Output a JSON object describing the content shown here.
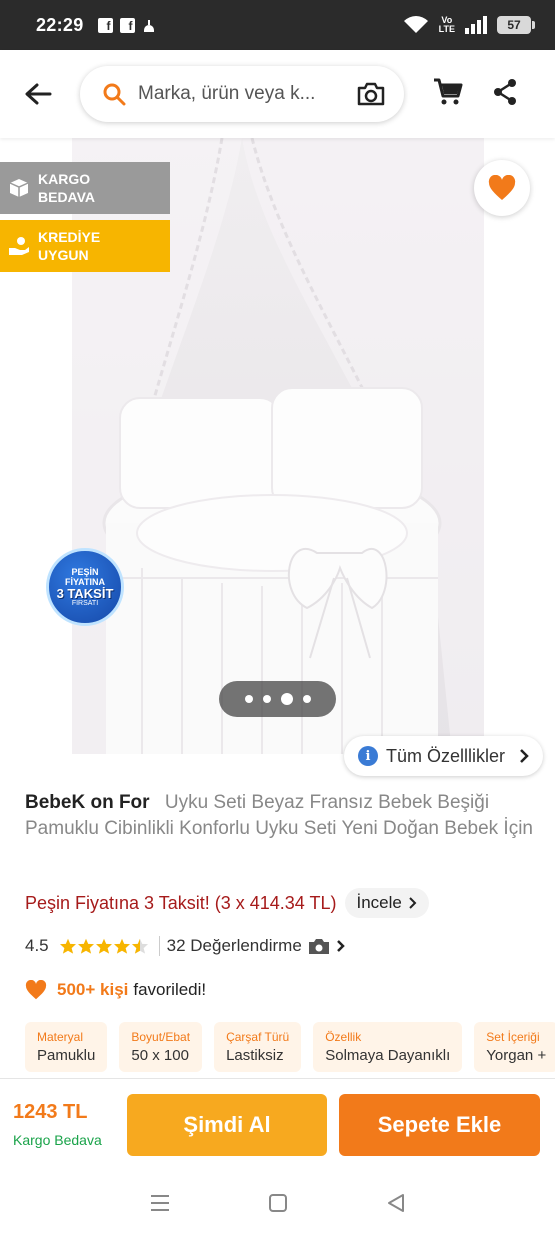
{
  "status": {
    "time": "22:29",
    "volte": [
      "Vo",
      "LTE"
    ],
    "battery": "57"
  },
  "search": {
    "placeholder": "Marka, ürün veya k..."
  },
  "badges": {
    "kargo": "KARGO BEDAVA",
    "kredi": "KREDİYE UYGUN"
  },
  "taksit_badge": {
    "line1": "PEŞİN FİYATINA",
    "line2": "3 TAKSİT",
    "line3": "FIRSATI"
  },
  "gallery": {
    "image_count": 4,
    "active_index": 2,
    "features_label": "Tüm Özelllikler"
  },
  "product": {
    "brand": "BebeK on For",
    "title": "Uyku Seti Beyaz Fransız Bebek Beşiği Pamuklu Cibinlikli Konforlu Uyku Seti Yeni Doğan Bebek İçin",
    "installment_text": "Peşin Fiyatına 3 Taksit! (3 x 414.34 TL)",
    "installment_link": "İncele",
    "rating": "4.5",
    "rating_value": 4.5,
    "review_count": "32 Değerlendirme",
    "fav_count": "500+ kişi",
    "fav_text": "favoriledi!"
  },
  "attributes": [
    {
      "key": "Materyal",
      "value": "Pamuklu"
    },
    {
      "key": "Boyut/Ebat",
      "value": "50 x 100"
    },
    {
      "key": "Çarşaf Türü",
      "value": "Lastiksiz"
    },
    {
      "key": "Özellik",
      "value": "Solmaya Dayanıklı"
    },
    {
      "key": "Set İçeriği",
      "value": "Yorgan +"
    }
  ],
  "bottom": {
    "price": "1243 TL",
    "shipping": "Kargo Bedava",
    "buy_now": "Şimdi Al",
    "add_to_cart": "Sepete Ekle"
  },
  "colors": {
    "accent": "#f27a1a",
    "buy": "#f7a91f",
    "kredi": "#f7b500",
    "kargo": "#9a9a9a",
    "installment": "#a61b1b",
    "shipping": "#1aa34a"
  }
}
